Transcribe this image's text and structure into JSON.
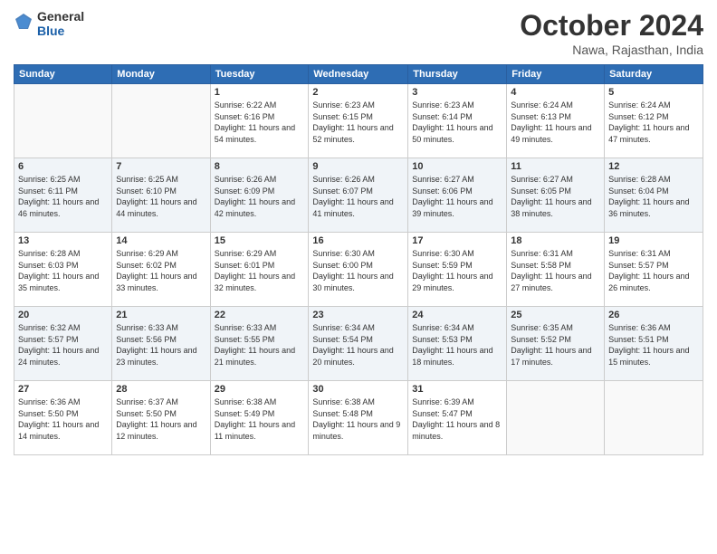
{
  "logo": {
    "general": "General",
    "blue": "Blue"
  },
  "title": "October 2024",
  "location": "Nawa, Rajasthan, India",
  "weekdays": [
    "Sunday",
    "Monday",
    "Tuesday",
    "Wednesday",
    "Thursday",
    "Friday",
    "Saturday"
  ],
  "weeks": [
    [
      {
        "day": "",
        "info": ""
      },
      {
        "day": "",
        "info": ""
      },
      {
        "day": "1",
        "info": "Sunrise: 6:22 AM\nSunset: 6:16 PM\nDaylight: 11 hours and 54 minutes."
      },
      {
        "day": "2",
        "info": "Sunrise: 6:23 AM\nSunset: 6:15 PM\nDaylight: 11 hours and 52 minutes."
      },
      {
        "day": "3",
        "info": "Sunrise: 6:23 AM\nSunset: 6:14 PM\nDaylight: 11 hours and 50 minutes."
      },
      {
        "day": "4",
        "info": "Sunrise: 6:24 AM\nSunset: 6:13 PM\nDaylight: 11 hours and 49 minutes."
      },
      {
        "day": "5",
        "info": "Sunrise: 6:24 AM\nSunset: 6:12 PM\nDaylight: 11 hours and 47 minutes."
      }
    ],
    [
      {
        "day": "6",
        "info": "Sunrise: 6:25 AM\nSunset: 6:11 PM\nDaylight: 11 hours and 46 minutes."
      },
      {
        "day": "7",
        "info": "Sunrise: 6:25 AM\nSunset: 6:10 PM\nDaylight: 11 hours and 44 minutes."
      },
      {
        "day": "8",
        "info": "Sunrise: 6:26 AM\nSunset: 6:09 PM\nDaylight: 11 hours and 42 minutes."
      },
      {
        "day": "9",
        "info": "Sunrise: 6:26 AM\nSunset: 6:07 PM\nDaylight: 11 hours and 41 minutes."
      },
      {
        "day": "10",
        "info": "Sunrise: 6:27 AM\nSunset: 6:06 PM\nDaylight: 11 hours and 39 minutes."
      },
      {
        "day": "11",
        "info": "Sunrise: 6:27 AM\nSunset: 6:05 PM\nDaylight: 11 hours and 38 minutes."
      },
      {
        "day": "12",
        "info": "Sunrise: 6:28 AM\nSunset: 6:04 PM\nDaylight: 11 hours and 36 minutes."
      }
    ],
    [
      {
        "day": "13",
        "info": "Sunrise: 6:28 AM\nSunset: 6:03 PM\nDaylight: 11 hours and 35 minutes."
      },
      {
        "day": "14",
        "info": "Sunrise: 6:29 AM\nSunset: 6:02 PM\nDaylight: 11 hours and 33 minutes."
      },
      {
        "day": "15",
        "info": "Sunrise: 6:29 AM\nSunset: 6:01 PM\nDaylight: 11 hours and 32 minutes."
      },
      {
        "day": "16",
        "info": "Sunrise: 6:30 AM\nSunset: 6:00 PM\nDaylight: 11 hours and 30 minutes."
      },
      {
        "day": "17",
        "info": "Sunrise: 6:30 AM\nSunset: 5:59 PM\nDaylight: 11 hours and 29 minutes."
      },
      {
        "day": "18",
        "info": "Sunrise: 6:31 AM\nSunset: 5:58 PM\nDaylight: 11 hours and 27 minutes."
      },
      {
        "day": "19",
        "info": "Sunrise: 6:31 AM\nSunset: 5:57 PM\nDaylight: 11 hours and 26 minutes."
      }
    ],
    [
      {
        "day": "20",
        "info": "Sunrise: 6:32 AM\nSunset: 5:57 PM\nDaylight: 11 hours and 24 minutes."
      },
      {
        "day": "21",
        "info": "Sunrise: 6:33 AM\nSunset: 5:56 PM\nDaylight: 11 hours and 23 minutes."
      },
      {
        "day": "22",
        "info": "Sunrise: 6:33 AM\nSunset: 5:55 PM\nDaylight: 11 hours and 21 minutes."
      },
      {
        "day": "23",
        "info": "Sunrise: 6:34 AM\nSunset: 5:54 PM\nDaylight: 11 hours and 20 minutes."
      },
      {
        "day": "24",
        "info": "Sunrise: 6:34 AM\nSunset: 5:53 PM\nDaylight: 11 hours and 18 minutes."
      },
      {
        "day": "25",
        "info": "Sunrise: 6:35 AM\nSunset: 5:52 PM\nDaylight: 11 hours and 17 minutes."
      },
      {
        "day": "26",
        "info": "Sunrise: 6:36 AM\nSunset: 5:51 PM\nDaylight: 11 hours and 15 minutes."
      }
    ],
    [
      {
        "day": "27",
        "info": "Sunrise: 6:36 AM\nSunset: 5:50 PM\nDaylight: 11 hours and 14 minutes."
      },
      {
        "day": "28",
        "info": "Sunrise: 6:37 AM\nSunset: 5:50 PM\nDaylight: 11 hours and 12 minutes."
      },
      {
        "day": "29",
        "info": "Sunrise: 6:38 AM\nSunset: 5:49 PM\nDaylight: 11 hours and 11 minutes."
      },
      {
        "day": "30",
        "info": "Sunrise: 6:38 AM\nSunset: 5:48 PM\nDaylight: 11 hours and 9 minutes."
      },
      {
        "day": "31",
        "info": "Sunrise: 6:39 AM\nSunset: 5:47 PM\nDaylight: 11 hours and 8 minutes."
      },
      {
        "day": "",
        "info": ""
      },
      {
        "day": "",
        "info": ""
      }
    ]
  ]
}
